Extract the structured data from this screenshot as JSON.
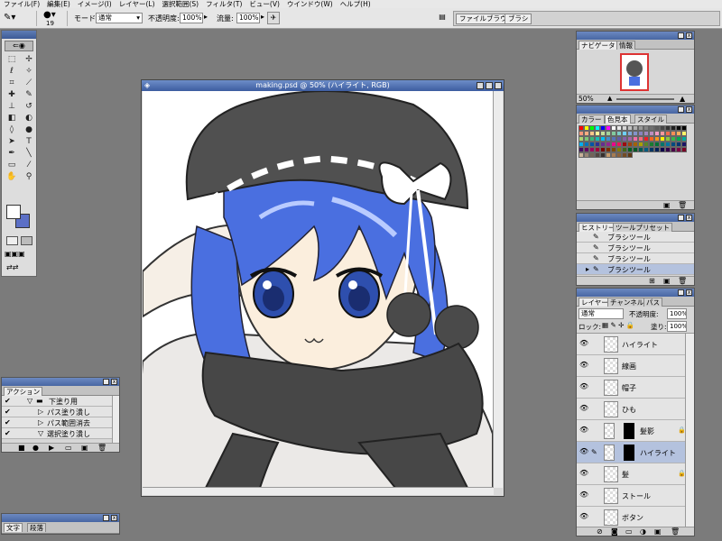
{
  "menu": [
    "ファイル(F)",
    "編集(E)",
    "イメージ(I)",
    "レイヤー(L)",
    "選択範囲(S)",
    "フィルタ(T)",
    "ビュー(V)",
    "ウインドウ(W)",
    "ヘルプ(H)"
  ],
  "options": {
    "brush_size": "19",
    "mode_label": "モード",
    "mode_value": "通常",
    "opacity_label": "不透明度:",
    "opacity_value": "100%",
    "flow_label": "流量:",
    "flow_value": "100%",
    "well_tabs": [
      "ファイルブラウザ",
      "ブラシ"
    ]
  },
  "navigator": {
    "tabs": [
      "ナビゲータ",
      "情報"
    ],
    "zoom": "50%"
  },
  "color": {
    "tabs": [
      "カラー",
      "色見本",
      "スタイル"
    ],
    "swatch_colors": [
      "#ff0000",
      "#ffff00",
      "#00ff00",
      "#00ffff",
      "#0000ff",
      "#ff00ff",
      "#ffffff",
      "#ebebeb",
      "#d6d6d6",
      "#c2c2c2",
      "#adadad",
      "#999999",
      "#858585",
      "#707070",
      "#5c5c5c",
      "#474747",
      "#333333",
      "#1f1f1f",
      "#0a0a0a",
      "#000000",
      "#f7977a",
      "#f9ad81",
      "#fdc68a",
      "#fff79a",
      "#c4df9b",
      "#a2d39c",
      "#82ca9d",
      "#7bcdc8",
      "#6ecff6",
      "#7ea7d8",
      "#8493ca",
      "#8882be",
      "#a187be",
      "#bc8dbf",
      "#f49ac2",
      "#f6989d",
      "#f26c4f",
      "#f68e55",
      "#fbaf5c",
      "#fff467",
      "#acd372",
      "#7cc576",
      "#3bb878",
      "#1abbb4",
      "#00bff3",
      "#438cca",
      "#5574b9",
      "#605ca8",
      "#855fa8",
      "#a763a8",
      "#f06ea9",
      "#f26d7d",
      "#ed1c24",
      "#f26522",
      "#f7941d",
      "#fff200",
      "#8dc73f",
      "#39b54a",
      "#00a651",
      "#00a99d",
      "#00aeef",
      "#0072bc",
      "#0054a6",
      "#2e3192",
      "#662d91",
      "#92278f",
      "#ec008c",
      "#ed145b",
      "#9e0b0f",
      "#a0410d",
      "#a36209",
      "#aba000",
      "#598527",
      "#197b30",
      "#007236",
      "#00746b",
      "#0076a3",
      "#004a80",
      "#003471",
      "#1b1464",
      "#440e62",
      "#630460",
      "#9e005d",
      "#9e0039",
      "#790000",
      "#7b2e00",
      "#7d4900",
      "#827b00",
      "#406618",
      "#005e20",
      "#005826",
      "#005952",
      "#005b7f",
      "#003663",
      "#002157",
      "#0d004c",
      "#32004b",
      "#4b0049",
      "#7b0046",
      "#7a0026",
      "#c7b299",
      "#998675",
      "#736357",
      "#534741",
      "#37302d",
      "#c69c6d",
      "#a67c52",
      "#8c6239",
      "#754c24",
      "#603913"
    ]
  },
  "history": {
    "tabs": [
      "ヒストリー",
      "ツールプリセット"
    ],
    "items": [
      "ブラシツール",
      "ブラシツール",
      "ブラシツール",
      "ブラシツール"
    ]
  },
  "layers": {
    "tabs": [
      "レイヤー",
      "チャンネル",
      "パス"
    ],
    "blend_mode": "通常",
    "opacity_label": "不透明度:",
    "opacity_value": "100%",
    "lock_label": "ロック:",
    "fill_label": "塗り:",
    "fill_value": "100%",
    "items": [
      "ハイライト",
      "線画",
      "帽子",
      "ひも",
      "髪影",
      "ハイライト",
      "髪",
      "ストール",
      "ボタン"
    ]
  },
  "actions": {
    "tab": "アクション",
    "items": [
      "下塗り用",
      "パス塗り潰し",
      "パス範囲消去",
      "選択塗り潰し"
    ]
  },
  "text_panel": {
    "tabs": [
      "文字",
      "段落"
    ]
  },
  "document": {
    "title": "making.psd @ 50% (ハイライト, RGB)"
  },
  "colors": {
    "accent": "#3d5da0",
    "hair": "#4a6fe0",
    "hat": "#505050",
    "skin": "#fbeedd"
  }
}
